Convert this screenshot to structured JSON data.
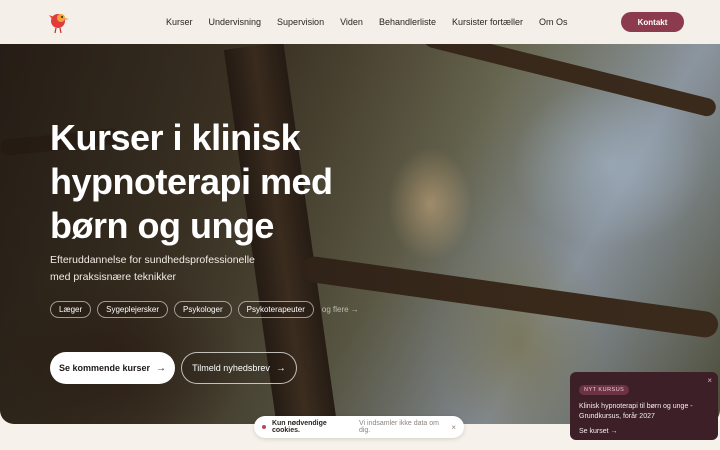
{
  "nav": {
    "items": [
      "Kurser",
      "Undervisning",
      "Supervision",
      "Viden",
      "Behandlerliste",
      "Kursister fortæller",
      "Om Os"
    ],
    "contact_label": "Kontakt"
  },
  "hero": {
    "title": "Kurser i klinisk hypnoterapi med børn og unge",
    "subtitle": "Efteruddannelse for sundhedsprofessionelle med praksisnære teknikker",
    "tags": [
      "Læger",
      "Sygeplejersker",
      "Psykologer",
      "Psykoterapeuter"
    ],
    "tags_more": "og flere →",
    "primary_button": "Se kommende kurser",
    "secondary_button": "Tilmeld nyhedsbrev",
    "arrow": "→"
  },
  "news_card": {
    "badge": "NYT KURSUS",
    "text": "Klinisk hypnoterapi til børn og unge - Grundkursus, forår 2027",
    "link": "Se kurset →",
    "close": "×"
  },
  "cookie": {
    "bold": "Kun nødvendige cookies.",
    "muted": "Vi indsamler ikke data om dig.",
    "close": "×"
  },
  "colors": {
    "accent": "#8c3b4e",
    "card_bg": "#3d1f28",
    "header_bg": "#f4efe8"
  },
  "icons": [
    "bird-logo-icon",
    "arrow-right-icon",
    "close-icon"
  ]
}
